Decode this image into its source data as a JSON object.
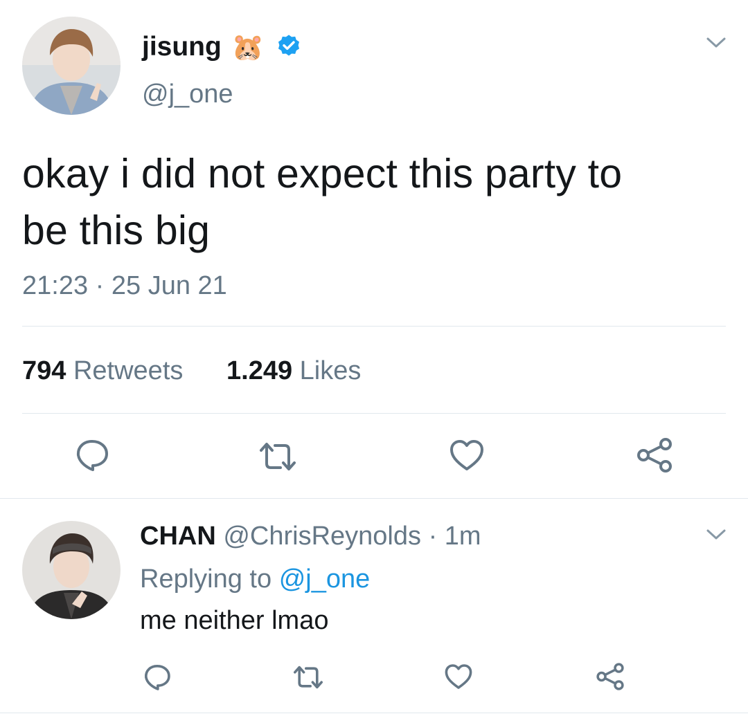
{
  "main_tweet": {
    "display_name": "jisung",
    "emoji": "🐹",
    "handle": "@j_one",
    "text": "okay i did not expect this party to be this big",
    "text_line1": "okay i did not expect this party to",
    "text_line2": "be this big",
    "timestamp": "21:23 · 25 Jun 21",
    "retweets_count": "794",
    "retweets_label": "Retweets",
    "likes_count": "1.249",
    "likes_label": "Likes"
  },
  "reply": {
    "display_name": "CHAN",
    "handle": "@ChrisReynolds",
    "time": "· 1m",
    "replying_label": "Replying to",
    "replying_handle": "@j_one",
    "text": "me neither lmao"
  },
  "icons": [
    "chevron-down-icon",
    "verified-badge-icon",
    "reply-icon",
    "retweet-icon",
    "like-icon",
    "share-icon"
  ],
  "colors": {
    "text": "#14171a",
    "secondary": "#657786",
    "link": "#1b95e0",
    "verified": "#1da1f2",
    "divider": "#e1e8ed"
  }
}
